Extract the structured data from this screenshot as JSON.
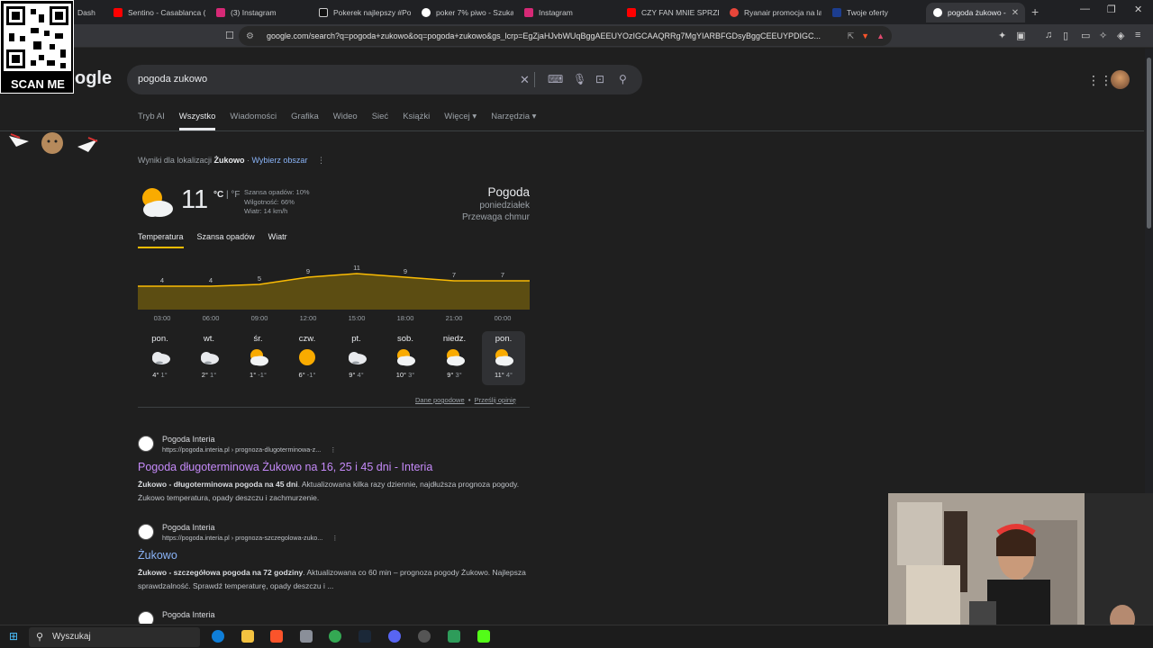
{
  "browser": {
    "tabs": [
      {
        "label": "Dash",
        "color": "#2b6fd6"
      },
      {
        "label": "Sentino - Casablanca (",
        "color": "#ff0000"
      },
      {
        "label": "(3) Instagram",
        "color": "#d62976"
      },
      {
        "label": "Pokerek najlepszy #Po",
        "color": "#111111"
      },
      {
        "label": "poker 7% piwo - Szuka",
        "color": "#ffffff"
      },
      {
        "label": "Instagram",
        "color": "#d62976"
      },
      {
        "label": "CZY FAN MNIE SPRZED",
        "color": "#ff0000"
      },
      {
        "label": "Ryanair promocja na la",
        "color": "#e8463a"
      },
      {
        "label": "Twoje oferty",
        "color": "#1c3d8f"
      },
      {
        "label": "pogoda żukowo -",
        "color": "#ffffff"
      }
    ],
    "new_tab_label": "+",
    "url": "google.com/search?q=pogoda+zukowo&oq=pogoda+zukowo&gs_lcrp=EgZjaHJvbWUqBggAEEUYOzIGCAAQRRg7MgYIARBFGDsyBggCEEUYPDIGC..."
  },
  "overlay": {
    "scan_label": "SCAN ME"
  },
  "search": {
    "logo_text": "ogle",
    "query": "pogoda zukowo",
    "nav_tabs": [
      "Tryb AI",
      "Wszystko",
      "Wiadomości",
      "Grafika",
      "Wideo",
      "Sieć",
      "Książki",
      "Więcej ▾",
      "Narzędzia ▾"
    ],
    "location_prefix": "Wyniki dla lokalizacji",
    "location_name": "Żukowo",
    "location_sep": "·",
    "location_link": "Wybierz obszar"
  },
  "weather": {
    "temp": "11",
    "unit_c": "°C",
    "unit_sep": " | ",
    "unit_f": "°F",
    "precip": "Szansa opadów: 10%",
    "humidity": "Wilgotność: 66%",
    "wind": "Wiatr: 14 km/h",
    "title": "Pogoda",
    "day": "poniedziałek",
    "condition": "Przewaga chmur",
    "tabs": [
      "Temperatura",
      "Szansa opadów",
      "Wiatr"
    ],
    "hourly_times": [
      "03:00",
      "06:00",
      "09:00",
      "12:00",
      "15:00",
      "18:00",
      "21:00",
      "00:00"
    ],
    "hourly_labels": [
      "4",
      "4",
      "5",
      "9",
      "11",
      "9",
      "7",
      "7"
    ],
    "days": [
      {
        "name": "pon.",
        "high": "4°",
        "low": "1°",
        "icon": "cloud-icon"
      },
      {
        "name": "wt.",
        "high": "2°",
        "low": "1°",
        "icon": "cloud-icon"
      },
      {
        "name": "śr.",
        "high": "1°",
        "low": "-1°",
        "icon": "partly-cloudy-icon"
      },
      {
        "name": "czw.",
        "high": "6°",
        "low": "-1°",
        "icon": "sun-icon"
      },
      {
        "name": "pt.",
        "high": "9°",
        "low": "4°",
        "icon": "cloud-icon"
      },
      {
        "name": "sob.",
        "high": "10°",
        "low": "3°",
        "icon": "partly-cloudy-icon"
      },
      {
        "name": "niedz.",
        "high": "9°",
        "low": "3°",
        "icon": "partly-cloudy-icon"
      },
      {
        "name": "pon.",
        "high": "11°",
        "low": "4°",
        "icon": "partly-cloudy-icon"
      }
    ],
    "footer_link1": "Dane pogodowe",
    "footer_sep": "•",
    "footer_link2": "Prześlij opinię",
    "colors": {
      "accent": "#fbbc04",
      "fill": "#5c4d12"
    }
  },
  "results": [
    {
      "site": "Pogoda Interia",
      "url": "https://pogoda.interia.pl › prognoza-dlugoterminowa-z...",
      "title": "Pogoda długoterminowa Żukowo na 16, 25 i 45 dni - Interia",
      "snippet_bold": "Żukowo - długoterminowa pogoda na 45 dni",
      "snippet": ". Aktualizowana kilka razy dziennie, najdłuższa prognoza pogody. Żukowo temperatura, opady deszczu i zachmurzenie."
    },
    {
      "site": "Pogoda Interia",
      "url": "https://pogoda.interia.pl › prognoza-szczegolowa-zuko...",
      "title": "Żukowo",
      "snippet_bold": "Żukowo - szczegółowa pogoda na 72 godziny",
      "snippet": ". Aktualizowana co 60 min – prognoza pogody Żukowo. Najlepsza sprawdzalność. Sprawdź temperaturę, opady deszczu i ..."
    },
    {
      "site": "Pogoda Interia"
    }
  ],
  "taskbar": {
    "search_label": "Wyszukaj"
  }
}
